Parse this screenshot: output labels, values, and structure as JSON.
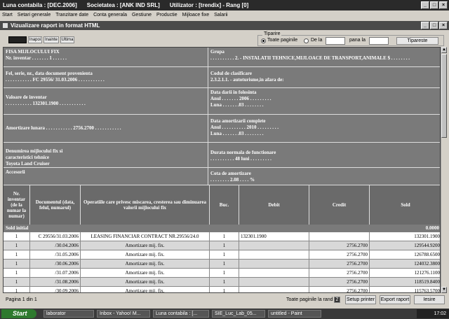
{
  "titlebar": {
    "luna_label": "Luna contabila : [DEC.2006]",
    "societatea_label": "Societatea : [ANK IND SRL]",
    "utilizator_label": "Utilizator : [trendix] - Rang [0]"
  },
  "menu": [
    "Start",
    "Setari generale",
    "Tranzitare date",
    "Conta generala",
    "Gestiune",
    "Productie",
    "Mijloace fixe",
    "Salarii"
  ],
  "child_window": {
    "title": "Vizualizare raport in format HTML",
    "nav": {
      "inapoi": "Inapoi",
      "inainte": "Inainte",
      "ultima": "Ultima"
    },
    "tiparire": {
      "legend": "Tiparire",
      "toate_paginile": "Toate paginile",
      "de_la": "De la",
      "pana_la": "pana la",
      "tipareste": "Tipareste"
    }
  },
  "report": {
    "fisa_title": "FISA MIJLOCULUI FIX",
    "nr_inventar": "Nr. inventar . . . . . . . 1 . . . . . .",
    "grupa_label": "Grupa",
    "grupa_value": ". . . . . . . . . . 2. - INSTALATII TEHNICE,MIJLOACE DE TRANSPORT,ANIMALE $ . . . . . . . .",
    "fel_label": "Fel, serie, nr., data document provenienta",
    "fel_value": ". . . . . . . . . . . FC 29556/ 31.03.2006 . . . . . . . . . . .",
    "cod_label": "Codul de clasificare",
    "cod_value": "2.3.2.1.1. - autoturisme,in afara de:",
    "valoare_label": "Valoare de inventar",
    "valoare_value": ". . . . . . . . . . . 132301.1900 . . . . . . . . . . .",
    "data_darii_label": "Data darii in folosinta",
    "data_darii_anul": "Anul . . . . . . . 2006 . . . . . . . . .",
    "data_darii_luna": "Luna . . . . . . .03 . . . . . . . .",
    "amortizare_label": "Amortizare lunara . . . . . . . . . . . 2756.2700 . . . . . . . . . . .",
    "data_amort_label": "Data amortizarii complete",
    "data_amort_anul": "Anul . . . . . . . . . . 2010 . . . . . . . . .",
    "data_amort_luna": "Luna . . . . . . .03 . . . . . . . .",
    "denumire_label": "Denumirea mijlocului fix si caracteristici tehnice",
    "denumire_value": "Toyota Land Cruiser",
    "durata_label": "Durata normala de functionare",
    "durata_value": ". . . . . . . . . . 48 luni . . . . . . . . .",
    "accesorii_label": "Accesorii",
    "cota_label": "Cota de amortizare",
    "cota_value": ". . . . . . . . 2.08 . . . . %",
    "columns": {
      "nr_inventar": "Nr. inventar (de la numar la numar)",
      "document": "Documentul (data, felul, numarul)",
      "operatiile": "Operatiile care privesc miscarea, cresterea sau diminuarea valorii mijlocului fix",
      "buc": "Buc.",
      "debit": "Debit",
      "credit": "Credit",
      "sold": "Sold"
    },
    "sold_initial_label": "Sold initial",
    "sold_initial_value": "0.0000",
    "rows": [
      {
        "nr": "1",
        "doc": "C 29556/31.03.2006",
        "op": "LEASING FINANCIAR CONTRACT NR.29556/24.0",
        "buc": "1",
        "debit": "132301.1900",
        "credit": "",
        "sold": "132301.1900"
      },
      {
        "nr": "1",
        "doc": "/30.04.2006",
        "op": "Amortizare mij. fix.",
        "buc": "1",
        "debit": "",
        "credit": "2756.2700",
        "sold": "129544.9200"
      },
      {
        "nr": "1",
        "doc": "/31.05.2006",
        "op": "Amortizare mij. fix.",
        "buc": "1",
        "debit": "",
        "credit": "2756.2700",
        "sold": "126788.6500"
      },
      {
        "nr": "1",
        "doc": "/30.06.2006",
        "op": "Amortizare mij. fix.",
        "buc": "1",
        "debit": "",
        "credit": "2756.2700",
        "sold": "124032.3800"
      },
      {
        "nr": "1",
        "doc": "/31.07.2006",
        "op": "Amortizare mij. fix.",
        "buc": "1",
        "debit": "",
        "credit": "2756.2700",
        "sold": "121276.1100"
      },
      {
        "nr": "1",
        "doc": "/31.08.2006",
        "op": "Amortizare mij. fix.",
        "buc": "1",
        "debit": "",
        "credit": "2756.2700",
        "sold": "118519.8400"
      },
      {
        "nr": "1",
        "doc": "/30.09.2006",
        "op": "Amortizare mij. fix.",
        "buc": "1",
        "debit": "",
        "credit": "2756.2700",
        "sold": "115763.5700"
      },
      {
        "nr": "1",
        "doc": "/31.10.2006",
        "op": "Amortizare mij. fix.",
        "buc": "1",
        "debit": "",
        "credit": "2756.2700",
        "sold": "113007.3000"
      }
    ]
  },
  "statusbar": {
    "pagina": "Pagina 1 din 1",
    "toate_paginile_rand": "Toate paginile la rand",
    "setup_printer": "Setup printer",
    "export_raport": "Export raport",
    "iesire": "Iesire"
  },
  "taskbar": {
    "start": "Start",
    "tasks": [
      "laborator",
      "Inbox - Yahoo! M...",
      "Luna contabila : [...",
      "SIE_Luc_Lab_05...",
      "untitled - Paint"
    ],
    "clock": "17:02"
  }
}
